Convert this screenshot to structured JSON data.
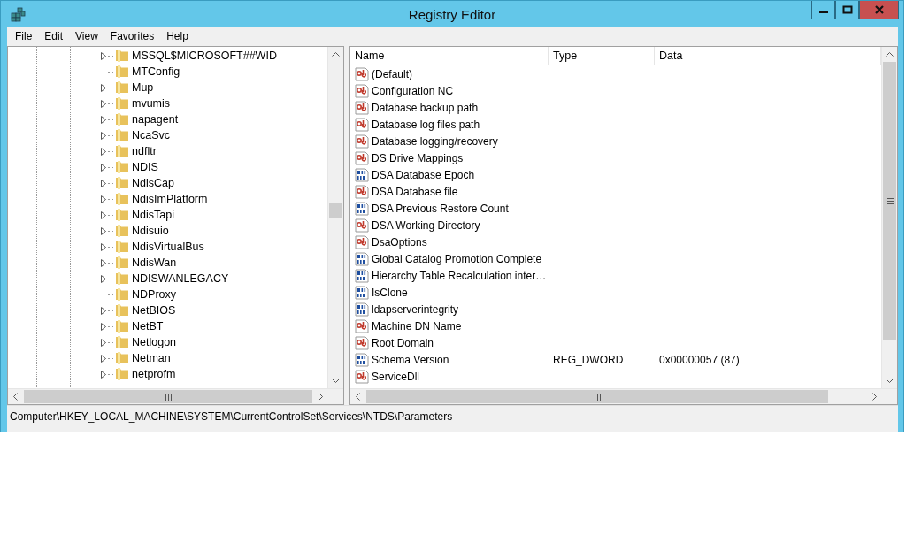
{
  "window": {
    "title": "Registry Editor"
  },
  "menu": [
    "File",
    "Edit",
    "View",
    "Favorites",
    "Help"
  ],
  "tree": {
    "items": [
      {
        "label": "MSSQL$MICROSOFT##WID",
        "expandable": true
      },
      {
        "label": "MTConfig",
        "expandable": false
      },
      {
        "label": "Mup",
        "expandable": true
      },
      {
        "label": "mvumis",
        "expandable": true
      },
      {
        "label": "napagent",
        "expandable": true
      },
      {
        "label": "NcaSvc",
        "expandable": true
      },
      {
        "label": "ndfltr",
        "expandable": true
      },
      {
        "label": "NDIS",
        "expandable": true
      },
      {
        "label": "NdisCap",
        "expandable": true
      },
      {
        "label": "NdisImPlatform",
        "expandable": true
      },
      {
        "label": "NdisTapi",
        "expandable": true
      },
      {
        "label": "Ndisuio",
        "expandable": true
      },
      {
        "label": "NdisVirtualBus",
        "expandable": true
      },
      {
        "label": "NdisWan",
        "expandable": true
      },
      {
        "label": "NDISWANLEGACY",
        "expandable": true
      },
      {
        "label": "NDProxy",
        "expandable": false
      },
      {
        "label": "NetBIOS",
        "expandable": true
      },
      {
        "label": "NetBT",
        "expandable": true
      },
      {
        "label": "Netlogon",
        "expandable": true
      },
      {
        "label": "Netman",
        "expandable": true
      },
      {
        "label": "netprofm",
        "expandable": true
      }
    ]
  },
  "values": {
    "columns": [
      "Name",
      "Type",
      "Data"
    ],
    "rows": [
      {
        "name": "(Default)",
        "kind": "string"
      },
      {
        "name": "Configuration NC",
        "kind": "string"
      },
      {
        "name": "Database backup path",
        "kind": "string"
      },
      {
        "name": "Database log files path",
        "kind": "string"
      },
      {
        "name": "Database logging/recovery",
        "kind": "string"
      },
      {
        "name": "DS Drive Mappings",
        "kind": "string"
      },
      {
        "name": "DSA Database Epoch",
        "kind": "dword"
      },
      {
        "name": "DSA Database file",
        "kind": "string"
      },
      {
        "name": "DSA Previous Restore Count",
        "kind": "dword"
      },
      {
        "name": "DSA Working Directory",
        "kind": "string"
      },
      {
        "name": "DsaOptions",
        "kind": "string"
      },
      {
        "name": "Global Catalog Promotion Complete",
        "kind": "dword"
      },
      {
        "name": "Hierarchy Table Recalculation inter…",
        "kind": "dword"
      },
      {
        "name": "IsClone",
        "kind": "dword"
      },
      {
        "name": "ldapserverintegrity",
        "kind": "dword"
      },
      {
        "name": "Machine DN Name",
        "kind": "string"
      },
      {
        "name": "Root Domain",
        "kind": "string"
      },
      {
        "name": "Schema Version",
        "kind": "dword",
        "type": "REG_DWORD",
        "data": "0x00000057 (87)"
      },
      {
        "name": "ServiceDll",
        "kind": "string"
      }
    ]
  },
  "status_bar": "Computer\\HKEY_LOCAL_MACHINE\\SYSTEM\\CurrentControlSet\\Services\\NTDS\\Parameters"
}
